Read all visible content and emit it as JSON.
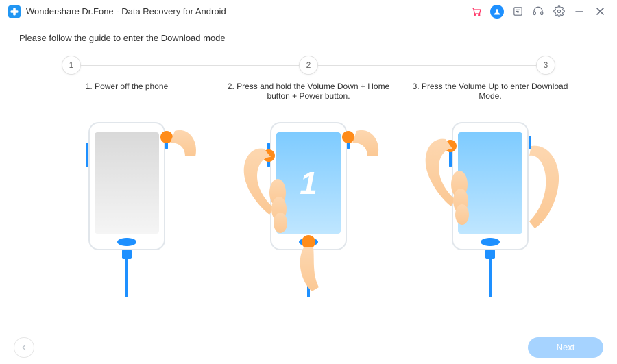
{
  "titlebar": {
    "title": "Wondershare Dr.Fone - Data Recovery for Android"
  },
  "guide": {
    "prompt": "Please follow the guide to enter the Download mode",
    "steps": {
      "s1": {
        "num": "1",
        "text": "1. Power off the phone"
      },
      "s2": {
        "num": "2",
        "text": "2. Press and hold the Volume Down + Home button + Power button."
      },
      "s3": {
        "num": "3",
        "text": "3. Press the Volume Up to enter Download Mode."
      }
    }
  },
  "footer": {
    "next_label": "Next"
  }
}
